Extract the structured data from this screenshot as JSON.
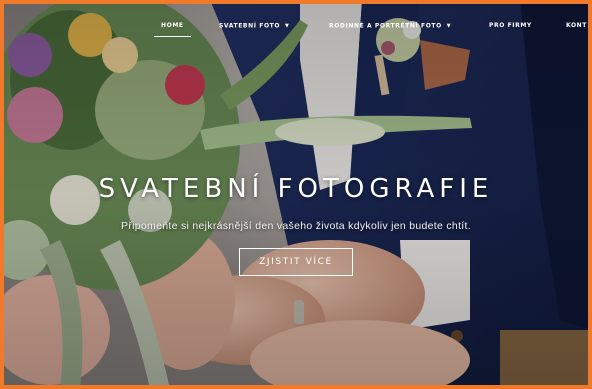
{
  "nav": {
    "items": [
      {
        "label": "HOME",
        "active": true
      },
      {
        "label": "SVATEBNÍ FOTO",
        "has_dropdown": true
      },
      {
        "label": "RODINNÉ A PORTRÉTNÍ FOTO",
        "has_dropdown": true
      },
      {
        "label": "PRO FIRMY"
      },
      {
        "label": "KONT"
      }
    ]
  },
  "hero": {
    "title": "SVATEBNÍ FOTOGRAFIE",
    "subtitle": "Připomeňte si nejkrásnější den vašeho života kdykoliv jen budete chtít.",
    "cta_label": "ZJISTIT VÍCE"
  },
  "colors": {
    "frame_border": "#f07a2a",
    "suit": "#1c2a55",
    "text": "#ffffff"
  }
}
